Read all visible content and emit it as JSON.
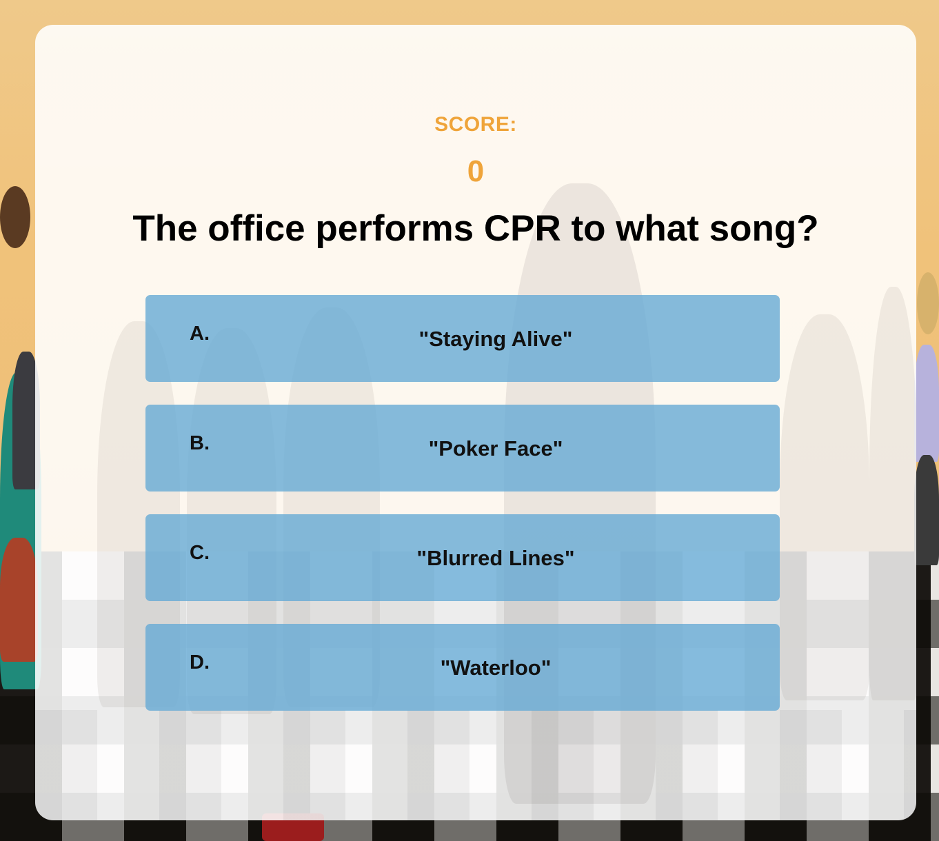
{
  "score": {
    "label": "SCORE:",
    "value": "0"
  },
  "question": {
    "text": "The office performs CPR to what song?"
  },
  "answers": [
    {
      "letter": "A.",
      "text": "\"Staying Alive\""
    },
    {
      "letter": "B.",
      "text": "\"Poker Face\""
    },
    {
      "letter": "C.",
      "text": "\"Blurred Lines\""
    },
    {
      "letter": "D.",
      "text": "\"Waterloo\""
    }
  ],
  "colors": {
    "background": "#efc98a",
    "score": "#efa43a",
    "answer_button": "#67aad4",
    "card": "#ffffff"
  }
}
